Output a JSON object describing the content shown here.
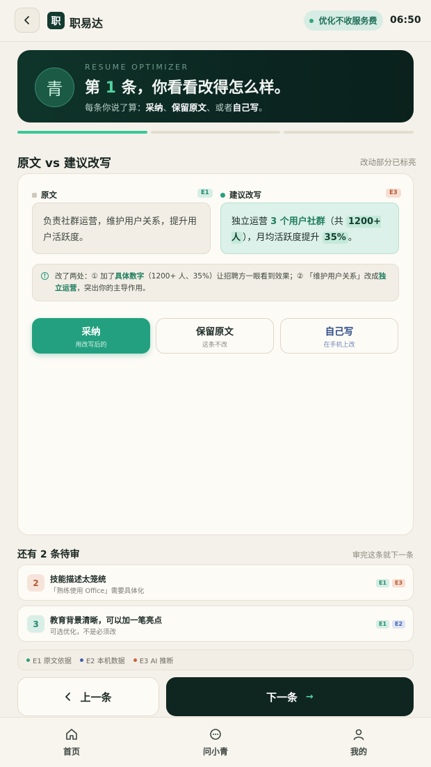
{
  "header": {
    "app_name": "职易达",
    "logo_char": "职",
    "badge": "优化不收服务费",
    "time": "06:50"
  },
  "hero": {
    "avatar_char": "青",
    "kicker": "RESUME OPTIMIZER",
    "title_prefix": "第",
    "title_num": "1",
    "title_suffix": "条，你看看改得怎么样。",
    "sub_prefix": "每条你说了算：",
    "sub_opt1": "采纳",
    "sub_sep1": "、",
    "sub_opt2": "保留原文",
    "sub_sep2": "、或者",
    "sub_opt3": "自己写",
    "sub_end": "。"
  },
  "progress": {
    "current": 1,
    "total": 3
  },
  "compare": {
    "title": "原文 vs 建议改写",
    "hint": "改动部分已标亮",
    "original": {
      "label": "原文",
      "tag": "E1",
      "text": "负责社群运营，维护用户关系，提升用户活跃度。"
    },
    "suggested": {
      "label": "建议改写",
      "tag": "E3",
      "p1": "独立运营 ",
      "h1": "3 个用户社群",
      "p2": "（共 ",
      "h2": "1200+ 人",
      "p3": "），月均活跃度提升 ",
      "h3": "35%",
      "p4": "。"
    },
    "note": {
      "icon": "!",
      "p1": "改了两处：① 加了",
      "b1": "具体数字",
      "p2": "（1200+ 人、35%）让招聘方一眼看到效果；② 「维护用户关系」改成",
      "b2": "独立运营",
      "p3": "，突出你的主导作用。"
    },
    "choices": [
      {
        "title": "采纳",
        "sub": "用改写后的"
      },
      {
        "title": "保留原文",
        "sub": "这条不改"
      },
      {
        "title": "自己写",
        "sub": "在手机上改"
      }
    ]
  },
  "pending": {
    "title": "还有 2 条待审",
    "hint": "审完这条就下一条",
    "items": [
      {
        "num": "2",
        "title": "技能描述太笼统",
        "sub": "「熟练使用 Office」需要具体化",
        "tags": [
          "E1",
          "E3"
        ]
      },
      {
        "num": "3",
        "title": "教育背景清晰，可以加一笔亮点",
        "sub": "可选优化，不是必须改",
        "tags": [
          "E1",
          "E2"
        ]
      }
    ]
  },
  "legend": [
    {
      "label": "E1 原文依据",
      "color": "#2a9d7c"
    },
    {
      "label": "E2 本机数据",
      "color": "#3f5fb0"
    },
    {
      "label": "E3 AI 推断",
      "color": "#c9653e"
    }
  ],
  "nav_buttons": {
    "prev": "上一条",
    "next": "下一条"
  },
  "tabs": [
    {
      "label": "首页",
      "icon": "home-icon"
    },
    {
      "label": "问小青",
      "icon": "chat-icon"
    },
    {
      "label": "我的",
      "icon": "user-icon"
    }
  ],
  "colors": {
    "accent": "#23a07f",
    "dark": "#0f2520",
    "e1": "#2a9d7c",
    "e2": "#3f5fb0",
    "e3": "#c9653e"
  }
}
